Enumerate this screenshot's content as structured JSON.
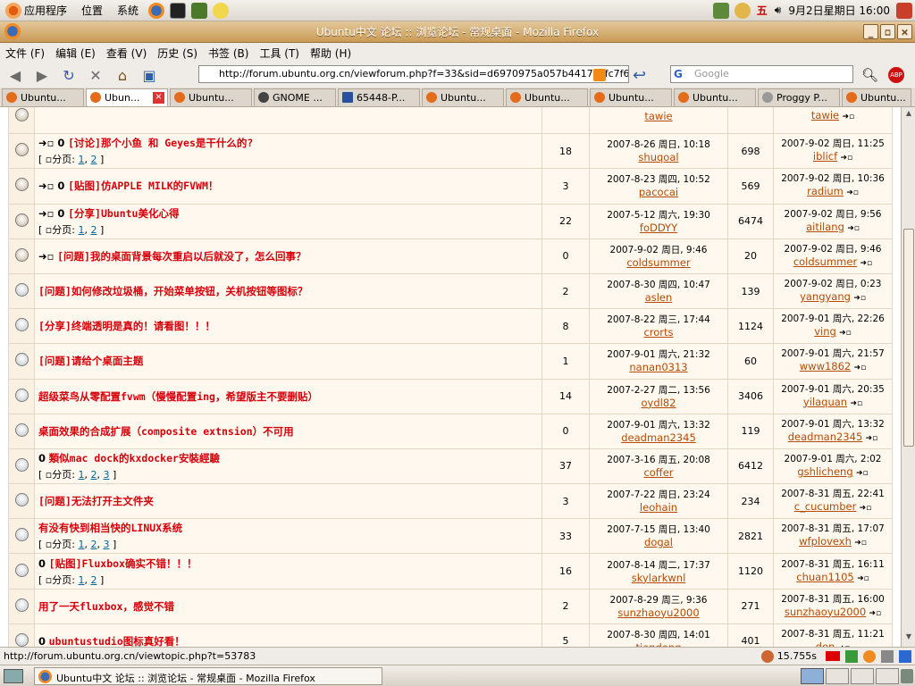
{
  "panel": {
    "menus": [
      "应用程序",
      "位置",
      "系统"
    ],
    "ime": "五",
    "clock": "9月2日星期日 16:00"
  },
  "window": {
    "title": "Ubuntu中文 论坛 :: 浏览论坛 - 常规桌面 - Mozilla Firefox"
  },
  "menubar": [
    "文件 (F)",
    "编辑 (E)",
    "查看 (V)",
    "历史 (S)",
    "书签 (B)",
    "工具 (T)",
    "帮助 (H)"
  ],
  "nav": {
    "url": "http://forum.ubuntu.org.cn/viewforum.php?f=33&sid=d6970975a057b44176cfc7f6",
    "search_placeholder": "Google"
  },
  "tabs": [
    "Ubuntu...",
    "Ubun...",
    "Ubuntu...",
    "GNOME ...",
    "65448-P...",
    "Ubuntu...",
    "Ubuntu...",
    "Ubuntu...",
    "Ubuntu...",
    "Proggy P...",
    "Ubuntu..."
  ],
  "topics": [
    {
      "title": "",
      "pages": null,
      "replies": "",
      "date": "",
      "author": "tawie",
      "views": "",
      "last_date": "",
      "last_user": "tawie",
      "icon": "hot"
    },
    {
      "prefix": "➜▫ 0",
      "title": "[讨论]那个小鱼 和 Geyes是干什么的?",
      "pages": [
        "1",
        "2"
      ],
      "replies": "18",
      "date": "2007-8-26 周日, 10:18",
      "author": "shuqoal",
      "views": "698",
      "last_date": "2007-9-02 周日, 11:25",
      "last_user": "iblicf",
      "icon": "hot"
    },
    {
      "prefix": "➜▫ 0",
      "title": "[贴图]仿APPLE MILK的FVWM！",
      "pages": null,
      "replies": "3",
      "date": "2007-8-23 周四, 10:52",
      "author": "pacocai",
      "views": "569",
      "last_date": "2007-9-02 周日, 10:36",
      "last_user": "radium",
      "icon": "hot"
    },
    {
      "prefix": "➜▫ 0",
      "title": "[分享]Ubuntu美化心得",
      "pages": [
        "1",
        "2"
      ],
      "replies": "22",
      "date": "2007-5-12 周六, 19:30",
      "author": "foDDYY",
      "views": "6474",
      "last_date": "2007-9-02 周日, 9:56",
      "last_user": "aitilang",
      "icon": "hot"
    },
    {
      "prefix": "➜▫",
      "title": "[问题]我的桌面背景每次重启以后就没了，怎么回事？",
      "pages": null,
      "replies": "0",
      "date": "2007-9-02 周日, 9:46",
      "author": "coldsummer",
      "views": "20",
      "last_date": "2007-9-02 周日, 9:46",
      "last_user": "coldsummer",
      "icon": "hot"
    },
    {
      "prefix": "",
      "title": "[问题]如何修改垃圾桶，开始菜单按钮，关机按钮等图标？",
      "pages": null,
      "replies": "2",
      "date": "2007-8-30 周四, 10:47",
      "author": "aslen",
      "views": "139",
      "last_date": "2007-9-02 周日, 0:23",
      "last_user": "yangyang",
      "icon": "normal"
    },
    {
      "prefix": "",
      "title": "[分享]终端透明是真的！请看图！！！",
      "pages": null,
      "replies": "8",
      "date": "2007-8-22 周三, 17:44",
      "author": "crorts",
      "views": "1124",
      "last_date": "2007-9-01 周六, 22:26",
      "last_user": "ving",
      "icon": "normal"
    },
    {
      "prefix": "",
      "title": "[问题]请给个桌面主题",
      "pages": null,
      "replies": "1",
      "date": "2007-9-01 周六, 21:32",
      "author": "nanan0313",
      "views": "60",
      "last_date": "2007-9-01 周六, 21:57",
      "last_user": "www1862",
      "icon": "normal"
    },
    {
      "prefix": "",
      "title": "超级菜鸟从零配置fvwm（慢慢配置ing，希望版主不要删贴）",
      "pages": null,
      "replies": "14",
      "date": "2007-2-27 周二, 13:56",
      "author": "oydl82",
      "views": "3406",
      "last_date": "2007-9-01 周六, 20:35",
      "last_user": "yilaquan",
      "icon": "normal"
    },
    {
      "prefix": "",
      "title": "桌面效果的合成扩展（composite extnsion）不可用",
      "pages": null,
      "replies": "0",
      "date": "2007-9-01 周六, 13:32",
      "author": "deadman2345",
      "views": "119",
      "last_date": "2007-9-01 周六, 13:32",
      "last_user": "deadman2345",
      "icon": "normal"
    },
    {
      "prefix": "0",
      "title": "類似mac dock的kxdocker安裝經驗",
      "pages": [
        "1",
        "2",
        "3"
      ],
      "replies": "37",
      "date": "2007-3-16 周五, 20:08",
      "author": "coffer",
      "views": "6412",
      "last_date": "2007-9-01 周六, 2:02",
      "last_user": "gshlicheng",
      "icon": "normal"
    },
    {
      "prefix": "",
      "title": "[问题]无法打开主文件夹",
      "pages": null,
      "replies": "3",
      "date": "2007-7-22 周日, 23:24",
      "author": "leohain",
      "views": "234",
      "last_date": "2007-8-31 周五, 22:41",
      "last_user": "c_cucumber",
      "icon": "normal"
    },
    {
      "prefix": "",
      "title": "有没有快到相当快的LINUX系统",
      "pages": [
        "1",
        "2",
        "3"
      ],
      "replies": "33",
      "date": "2007-7-15 周日, 13:40",
      "author": "dogal",
      "views": "2821",
      "last_date": "2007-8-31 周五, 17:07",
      "last_user": "wfplovexh",
      "icon": "normal"
    },
    {
      "prefix": "0",
      "title": "[贴图]Fluxbox确实不错！！！",
      "pages": [
        "1",
        "2"
      ],
      "replies": "16",
      "date": "2007-8-14 周二, 17:37",
      "author": "skylarkwnl",
      "views": "1120",
      "last_date": "2007-8-31 周五, 16:11",
      "last_user": "chuan1105",
      "icon": "normal"
    },
    {
      "prefix": "",
      "title": "用了一天fluxbox，感觉不错",
      "pages": null,
      "replies": "2",
      "date": "2007-8-29 周三, 9:36",
      "author": "sunzhaoyu2000",
      "views": "271",
      "last_date": "2007-8-31 周五, 16:00",
      "last_user": "sunzhaoyu2000",
      "icon": "normal"
    },
    {
      "prefix": "0",
      "title": "ubuntustudio图标真好看！",
      "pages": null,
      "replies": "5",
      "date": "2007-8-30 周四, 14:01",
      "author": "tiandong",
      "views": "401",
      "last_date": "2007-8-31 周五, 11:21",
      "last_user": "den",
      "icon": "normal"
    }
  ],
  "labels": {
    "pages": "分页:",
    "last_arrow": "➜▫"
  },
  "status": {
    "url": "http://forum.ubuntu.org.cn/viewtopic.php?t=53783",
    "time": "15.755s"
  },
  "taskbar": {
    "label": "Ubuntu中文 论坛 :: 浏览论坛 - 常规桌面 - Mozilla Firefox"
  }
}
